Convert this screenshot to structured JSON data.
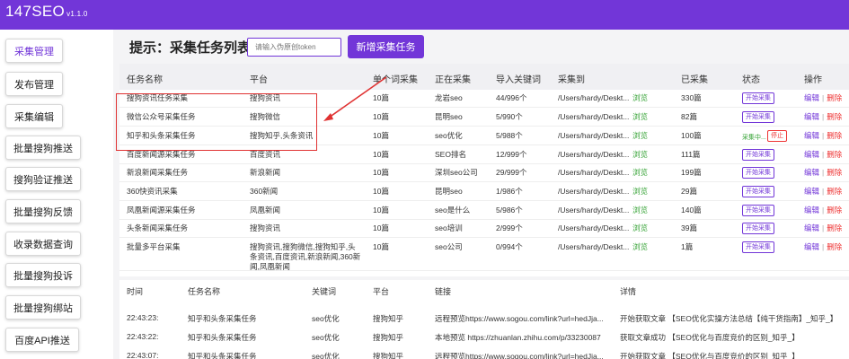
{
  "app": {
    "name": "147SEO",
    "version": "v1.1.0"
  },
  "sidebar": {
    "items": [
      {
        "label": "采集管理",
        "active": true
      },
      {
        "label": "发布管理"
      },
      {
        "label": "采集编辑"
      },
      {
        "label": "批量搜狗推送"
      },
      {
        "label": "搜狗验证推送"
      },
      {
        "label": "批量搜狗反馈"
      },
      {
        "label": "收录数据查询"
      },
      {
        "label": "批量搜狗投诉"
      },
      {
        "label": "批量搜狗绑站"
      },
      {
        "label": "百度API推送"
      }
    ]
  },
  "header": {
    "title": "提示：采集任务列表",
    "search_placeholder": "请输入伪原创token",
    "add_button": "新增采集任务"
  },
  "table": {
    "columns": [
      "任务名称",
      "平台",
      "单个词采集",
      "正在采集",
      "导入关键词",
      "采集到",
      "已采集",
      "状态",
      "操作"
    ],
    "browse_label": "浏览",
    "start_label": "开始采集",
    "running_label": "采集中...",
    "stop_label": "停止",
    "edit_label": "编辑",
    "delete_label": "删除",
    "rows": [
      {
        "name": "搜狗资讯任务采集",
        "platform": "搜狗资讯",
        "per_word": "10篇",
        "current": "龙岩seo",
        "keywords": "44/996个",
        "path": "/Users/hardy/Deskt...",
        "collected": "330篇",
        "status": "start"
      },
      {
        "name": "微信公众号采集任务",
        "platform": "搜狗微信",
        "per_word": "10篇",
        "current": "昆明seo",
        "keywords": "5/990个",
        "path": "/Users/hardy/Deskt...",
        "collected": "82篇",
        "status": "start"
      },
      {
        "name": "知乎和头条采集任务",
        "platform": "搜狗知乎,头条资讯",
        "per_word": "10篇",
        "current": "seo优化",
        "keywords": "5/988个",
        "path": "/Users/hardy/Deskt...",
        "collected": "100篇",
        "status": "running"
      },
      {
        "name": "百度新闻源采集任务",
        "platform": "百度资讯",
        "per_word": "10篇",
        "current": "SEO排名",
        "keywords": "12/999个",
        "path": "/Users/hardy/Deskt...",
        "collected": "111篇",
        "status": "start"
      },
      {
        "name": "新浪新闻采集任务",
        "platform": "新浪新闻",
        "per_word": "10篇",
        "current": "深圳seo公司",
        "keywords": "29/999个",
        "path": "/Users/hardy/Deskt...",
        "collected": "199篇",
        "status": "start"
      },
      {
        "name": "360快资讯采集",
        "platform": "360新闻",
        "per_word": "10篇",
        "current": "昆明seo",
        "keywords": "1/986个",
        "path": "/Users/hardy/Deskt...",
        "collected": "29篇",
        "status": "start"
      },
      {
        "name": "凤凰新闻源采集任务",
        "platform": "凤凰新闻",
        "per_word": "10篇",
        "current": "seo是什么",
        "keywords": "5/986个",
        "path": "/Users/hardy/Deskt...",
        "collected": "140篇",
        "status": "start"
      },
      {
        "name": "头条新闻采集任务",
        "platform": "搜狗资讯",
        "per_word": "10篇",
        "current": "seo培训",
        "keywords": "2/999个",
        "path": "/Users/hardy/Deskt...",
        "collected": "39篇",
        "status": "start"
      },
      {
        "name": "批量多平台采集",
        "platform": "搜狗资讯,搜狗微信,搜狗知乎,头条资讯,百度资讯,新浪新闻,360新闻,凤凰新闻",
        "per_word": "10篇",
        "current": "seo公司",
        "keywords": "0/994个",
        "path": "/Users/hardy/Deskt...",
        "collected": "1篇",
        "status": "start"
      }
    ]
  },
  "log": {
    "columns": [
      "时间",
      "任务名称",
      "关键词",
      "平台",
      "链接",
      "详情"
    ],
    "rows": [
      {
        "time": "22:43:23:",
        "task": "知乎和头条采集任务",
        "keyword": "seo优化",
        "platform": "搜狗知乎",
        "link": "远程预览https://www.sogou.com/link?url=hedJja...",
        "link_green": false,
        "detail": "开始获取文章 【SEO优化实操方法总结【纯干货指南】_知乎_】"
      },
      {
        "time": "22:43:22:",
        "task": "知乎和头条采集任务",
        "keyword": "seo优化",
        "platform": "搜狗知乎",
        "link": "本地预览 https://zhuanlan.zhihu.com/p/33230087",
        "link_green": true,
        "detail": "获取文章成功 【SEO优化与百度竞价的区别_知乎_】"
      },
      {
        "time": "22:43:07:",
        "task": "知乎和头条采集任务",
        "keyword": "seo优化",
        "platform": "搜狗知乎",
        "link": "远程预览https://www.sogou.com/link?url=hedJja...",
        "link_green": false,
        "detail": "开始获取文章 【SEO优化与百度竞价的区别_知乎_】"
      }
    ]
  },
  "colors": {
    "accent": "#7236d8",
    "danger": "#e33333",
    "success": "#36a336",
    "highlight": "#e03232"
  }
}
